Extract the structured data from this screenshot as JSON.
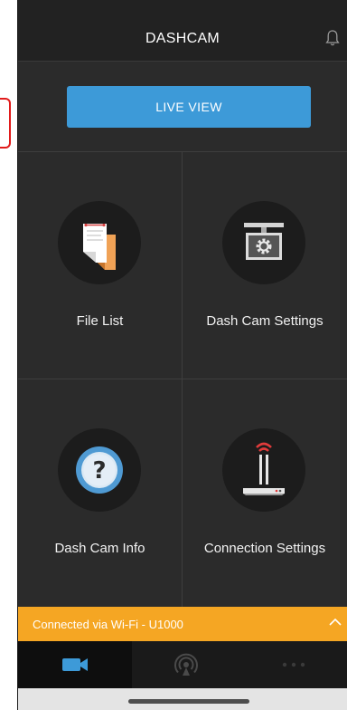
{
  "header": {
    "title": "DASHCAM",
    "notification_icon": "bell-icon"
  },
  "live_view": {
    "label": "LIVE VIEW"
  },
  "menu": {
    "items": [
      {
        "label": "File List",
        "icon": "file-list-icon"
      },
      {
        "label": "Dash Cam Settings",
        "icon": "dashcam-settings-icon"
      },
      {
        "label": "Dash Cam Info",
        "icon": "question-icon"
      },
      {
        "label": "Connection Settings",
        "icon": "router-icon"
      }
    ]
  },
  "status": {
    "text": "Connected via Wi-Fi - U1000",
    "icon": "chevron-up-icon"
  },
  "tabs": [
    {
      "name": "camera",
      "icon": "camera-icon",
      "active": true
    },
    {
      "name": "remote",
      "icon": "signal-icon",
      "active": false
    },
    {
      "name": "more",
      "icon": "more-icon",
      "active": false
    }
  ],
  "colors": {
    "accent_blue": "#3d9ad8",
    "status_orange": "#f5a623",
    "background": "#2b2b2b",
    "header": "#222222",
    "router_signal": "#e23b3b"
  }
}
